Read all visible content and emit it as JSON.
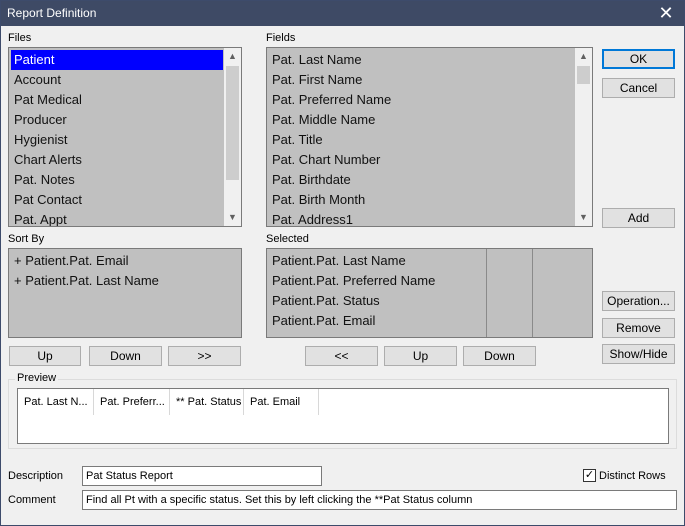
{
  "window": {
    "title": "Report Definition",
    "close_glyph": "✕"
  },
  "files": {
    "label": "Files",
    "items": [
      "Patient",
      "Account",
      "Pat Medical",
      "Producer",
      "Hygienist",
      "Chart Alerts",
      "Pat. Notes",
      "Pat Contact",
      "Pat. Appt"
    ],
    "selected_index": 0
  },
  "fields": {
    "label": "Fields",
    "items": [
      "Pat. Last Name",
      "Pat. First Name",
      "Pat. Preferred Name",
      "Pat. Middle Name",
      "Pat. Title",
      "Pat. Chart Number",
      "Pat. Birthdate",
      "Pat. Birth Month",
      "Pat. Address1"
    ]
  },
  "sort_by": {
    "label": "Sort By",
    "items": [
      "+  Patient.Pat. Email",
      "+  Patient.Pat. Last Name"
    ]
  },
  "selected": {
    "label": "Selected",
    "items": [
      "Patient.Pat. Last Name",
      "Patient.Pat. Preferred Name",
      "Patient.Pat. Status",
      "Patient.Pat. Email"
    ]
  },
  "buttons": {
    "ok": "OK",
    "cancel": "Cancel",
    "add": "Add",
    "operation": "Operation...",
    "remove": "Remove",
    "show_hide": "Show/Hide",
    "sort_up": "Up",
    "sort_down": "Down",
    "sort_move": ">>",
    "sel_back": "<<",
    "sel_up": "Up",
    "sel_down": "Down"
  },
  "preview": {
    "label": "Preview",
    "columns": [
      "Pat. Last N...",
      "Pat. Preferr...",
      "** Pat. Status",
      "Pat. Email"
    ]
  },
  "description": {
    "label": "Description",
    "value": "Pat Status Report"
  },
  "comment": {
    "label": "Comment",
    "value": "Find all Pt with a specific status. Set this by left clicking the **Pat Status  column"
  },
  "distinct_rows": {
    "label": "Distinct Rows",
    "checked": true,
    "check_glyph": "✓"
  },
  "icons": {
    "scroll_up": "▲",
    "scroll_down": "▼"
  }
}
